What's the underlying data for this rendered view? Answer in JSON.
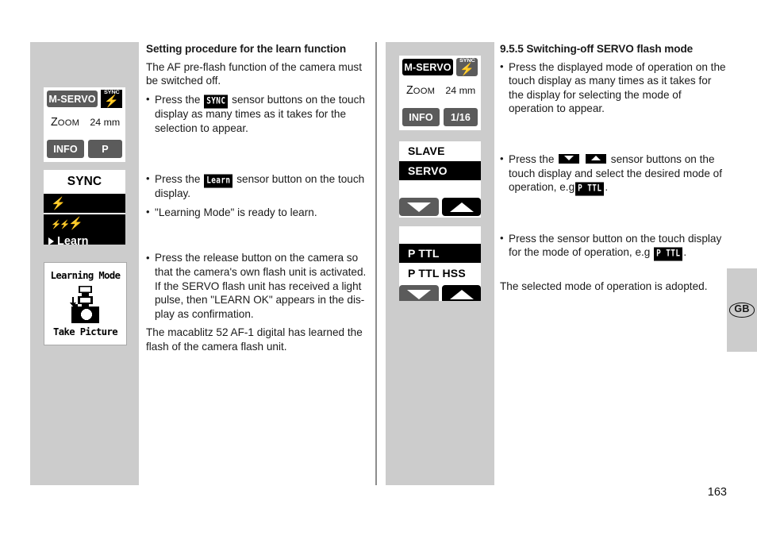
{
  "page": {
    "number": "163",
    "language_tab": "GB"
  },
  "middle_column": {
    "heading": "Setting procedure for the learn function",
    "intro": "The AF pre-flash function of the camera must be switched off.",
    "bullets": [
      {
        "pre": "Press the",
        "glyph": "SYNC",
        "post": "sensor buttons on the touch display as many times as it takes for the selection to appear."
      },
      {
        "pre": "Press the",
        "glyph": "Learn",
        "post": "sensor button on the touch display."
      },
      {
        "pre": "\"Learning Mode\" is ready to learn.",
        "glyph": "",
        "post": ""
      },
      {
        "pre": "Press the release button on the camera so that the camera's own flash unit is activated.",
        "glyph": "",
        "post": "If the SERVO flash unit has received a light pulse, then \"LEARN OK\" appears in the dis-play as confirmation."
      }
    ],
    "closing": "The macablitz 52 AF-1 digital has learned the flash of the camera flash unit."
  },
  "right_column": {
    "heading": "9.5.5 Switching-off SERVO flash mode",
    "bullets": [
      {
        "text": "Press the displayed mode of operation on the touch display as many times as it takes for the display for selecting the mode of operation to appear."
      },
      {
        "pre": "Press the",
        "arrows": [
          "down-arrow",
          "up-arrow"
        ],
        "mid": "sensor buttons on the touch display and select the desired mode of operation, e.g",
        "glyph": "P TTL",
        "post": "."
      },
      {
        "pre": "Press the sensor button on the touch display for the mode of operation, e.g",
        "glyph": "P TTL",
        "post": "."
      }
    ],
    "closing": "The selected mode of operation is adopted."
  },
  "left_panel": {
    "display_status": {
      "mode_tag": "M-SERVO",
      "sync_badge_label": "SYNC",
      "sync_badge_icon": "flash-bolt-icon",
      "zoom_label": "Zoom",
      "zoom_value": "24 mm",
      "info_button": "INFO",
      "right_button": "P"
    },
    "display_sync_menu": {
      "title": "SYNC",
      "row_single_bolt_icon": "flash-bolt-icon",
      "row_triple_bolt_icon": "triple-flash-bolt-icon",
      "row_learn": "Learn"
    },
    "display_learning": {
      "title": "Learning Mode",
      "artwork": "camera-with-flash-icon",
      "footer": "Take Picture"
    }
  },
  "third_panel": {
    "display_status": {
      "mode_tag": "M-SERVO",
      "sync_badge_label": "SYNC",
      "sync_badge_icon": "flash-bolt-icon",
      "zoom_label": "Zoom",
      "zoom_value": "24 mm",
      "info_button": "INFO",
      "right_button": "1/16"
    },
    "display_mode_list_1": {
      "rows": [
        {
          "label": "SLAVE",
          "selected": false
        },
        {
          "label": "SERVO",
          "selected": true
        },
        {
          "label": "",
          "selected": false
        }
      ],
      "nav_down": "down-arrow",
      "nav_up": "up-arrow"
    },
    "display_mode_list_2": {
      "rows": [
        {
          "label": "",
          "selected": false
        },
        {
          "label": "P TTL",
          "selected": true
        },
        {
          "label": "P TTL HSS",
          "selected": false
        }
      ],
      "nav_down": "down-arrow",
      "nav_up": "up-arrow"
    }
  },
  "colors": {
    "panel_gray": "#cccccc",
    "button_gray": "#5b5b5b",
    "lcd_black": "#000000",
    "lcd_white": "#ffffff",
    "divider": "#8d8d8d"
  }
}
